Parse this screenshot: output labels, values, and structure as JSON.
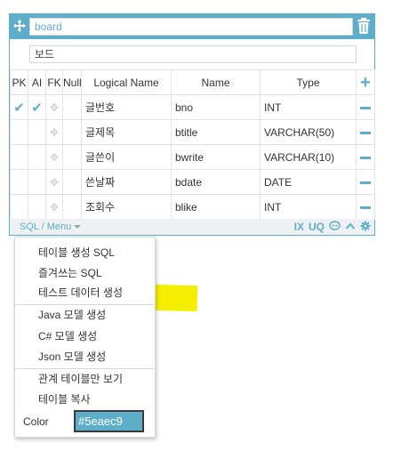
{
  "table": {
    "name": "board",
    "comment": "보드",
    "accent_color": "#5eaec9"
  },
  "columns_header": {
    "pk": "PK",
    "ai": "AI",
    "fk": "FK",
    "null": "Null",
    "logical_name": "Logical Name",
    "name": "Name",
    "type": "Type"
  },
  "rows": [
    {
      "pk": true,
      "ai": true,
      "logical": "글번호",
      "name": "bno",
      "type": "INT"
    },
    {
      "pk": false,
      "ai": false,
      "logical": "글제목",
      "name": "btitle",
      "type": "VARCHAR(50)"
    },
    {
      "pk": false,
      "ai": false,
      "logical": "글쓴이",
      "name": "bwrite",
      "type": "VARCHAR(10)"
    },
    {
      "pk": false,
      "ai": false,
      "logical": "쓴날짜",
      "name": "bdate",
      "type": "DATE"
    },
    {
      "pk": false,
      "ai": false,
      "logical": "조회수",
      "name": "blike",
      "type": "INT"
    }
  ],
  "footer": {
    "sql_menu_label": "SQL / Menu",
    "ix_label": "IX",
    "uq_label": "UQ"
  },
  "menu": {
    "items": [
      "테이블 생성 SQL",
      "즐겨쓰는 SQL",
      "테스트 데이터 생성",
      "Java 모델 생성",
      "C# 모델 생성",
      "Json 모델 생성",
      "관계 테이블만 보기",
      "테이블 복사"
    ],
    "color_label": "Color",
    "color_value": "#5eaec9",
    "highlight_color": "#f6ee00"
  }
}
